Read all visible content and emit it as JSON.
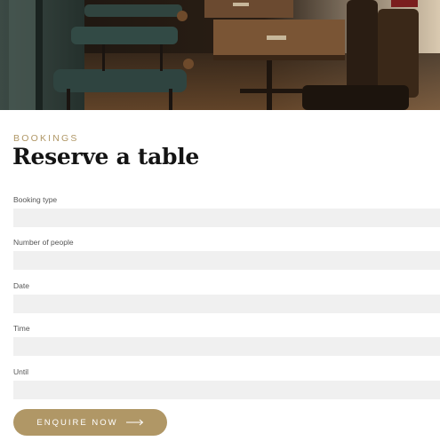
{
  "header": {
    "image": "restaurant-interior-photo"
  },
  "section": {
    "eyebrow": "BOOKINGS",
    "title": "Reserve a table"
  },
  "form": {
    "fields": [
      {
        "label": "Booking type",
        "value": ""
      },
      {
        "label": "Number of people",
        "value": ""
      },
      {
        "label": "Date",
        "value": ""
      },
      {
        "label": "Time",
        "value": ""
      },
      {
        "label": "Until",
        "value": ""
      }
    ],
    "submit_label": "ENQUIRE NOW",
    "submit_icon": "arrow-right-icon"
  },
  "colors": {
    "accent": "#b09766",
    "field_bg": "#f0f0f0",
    "title": "#141414"
  }
}
